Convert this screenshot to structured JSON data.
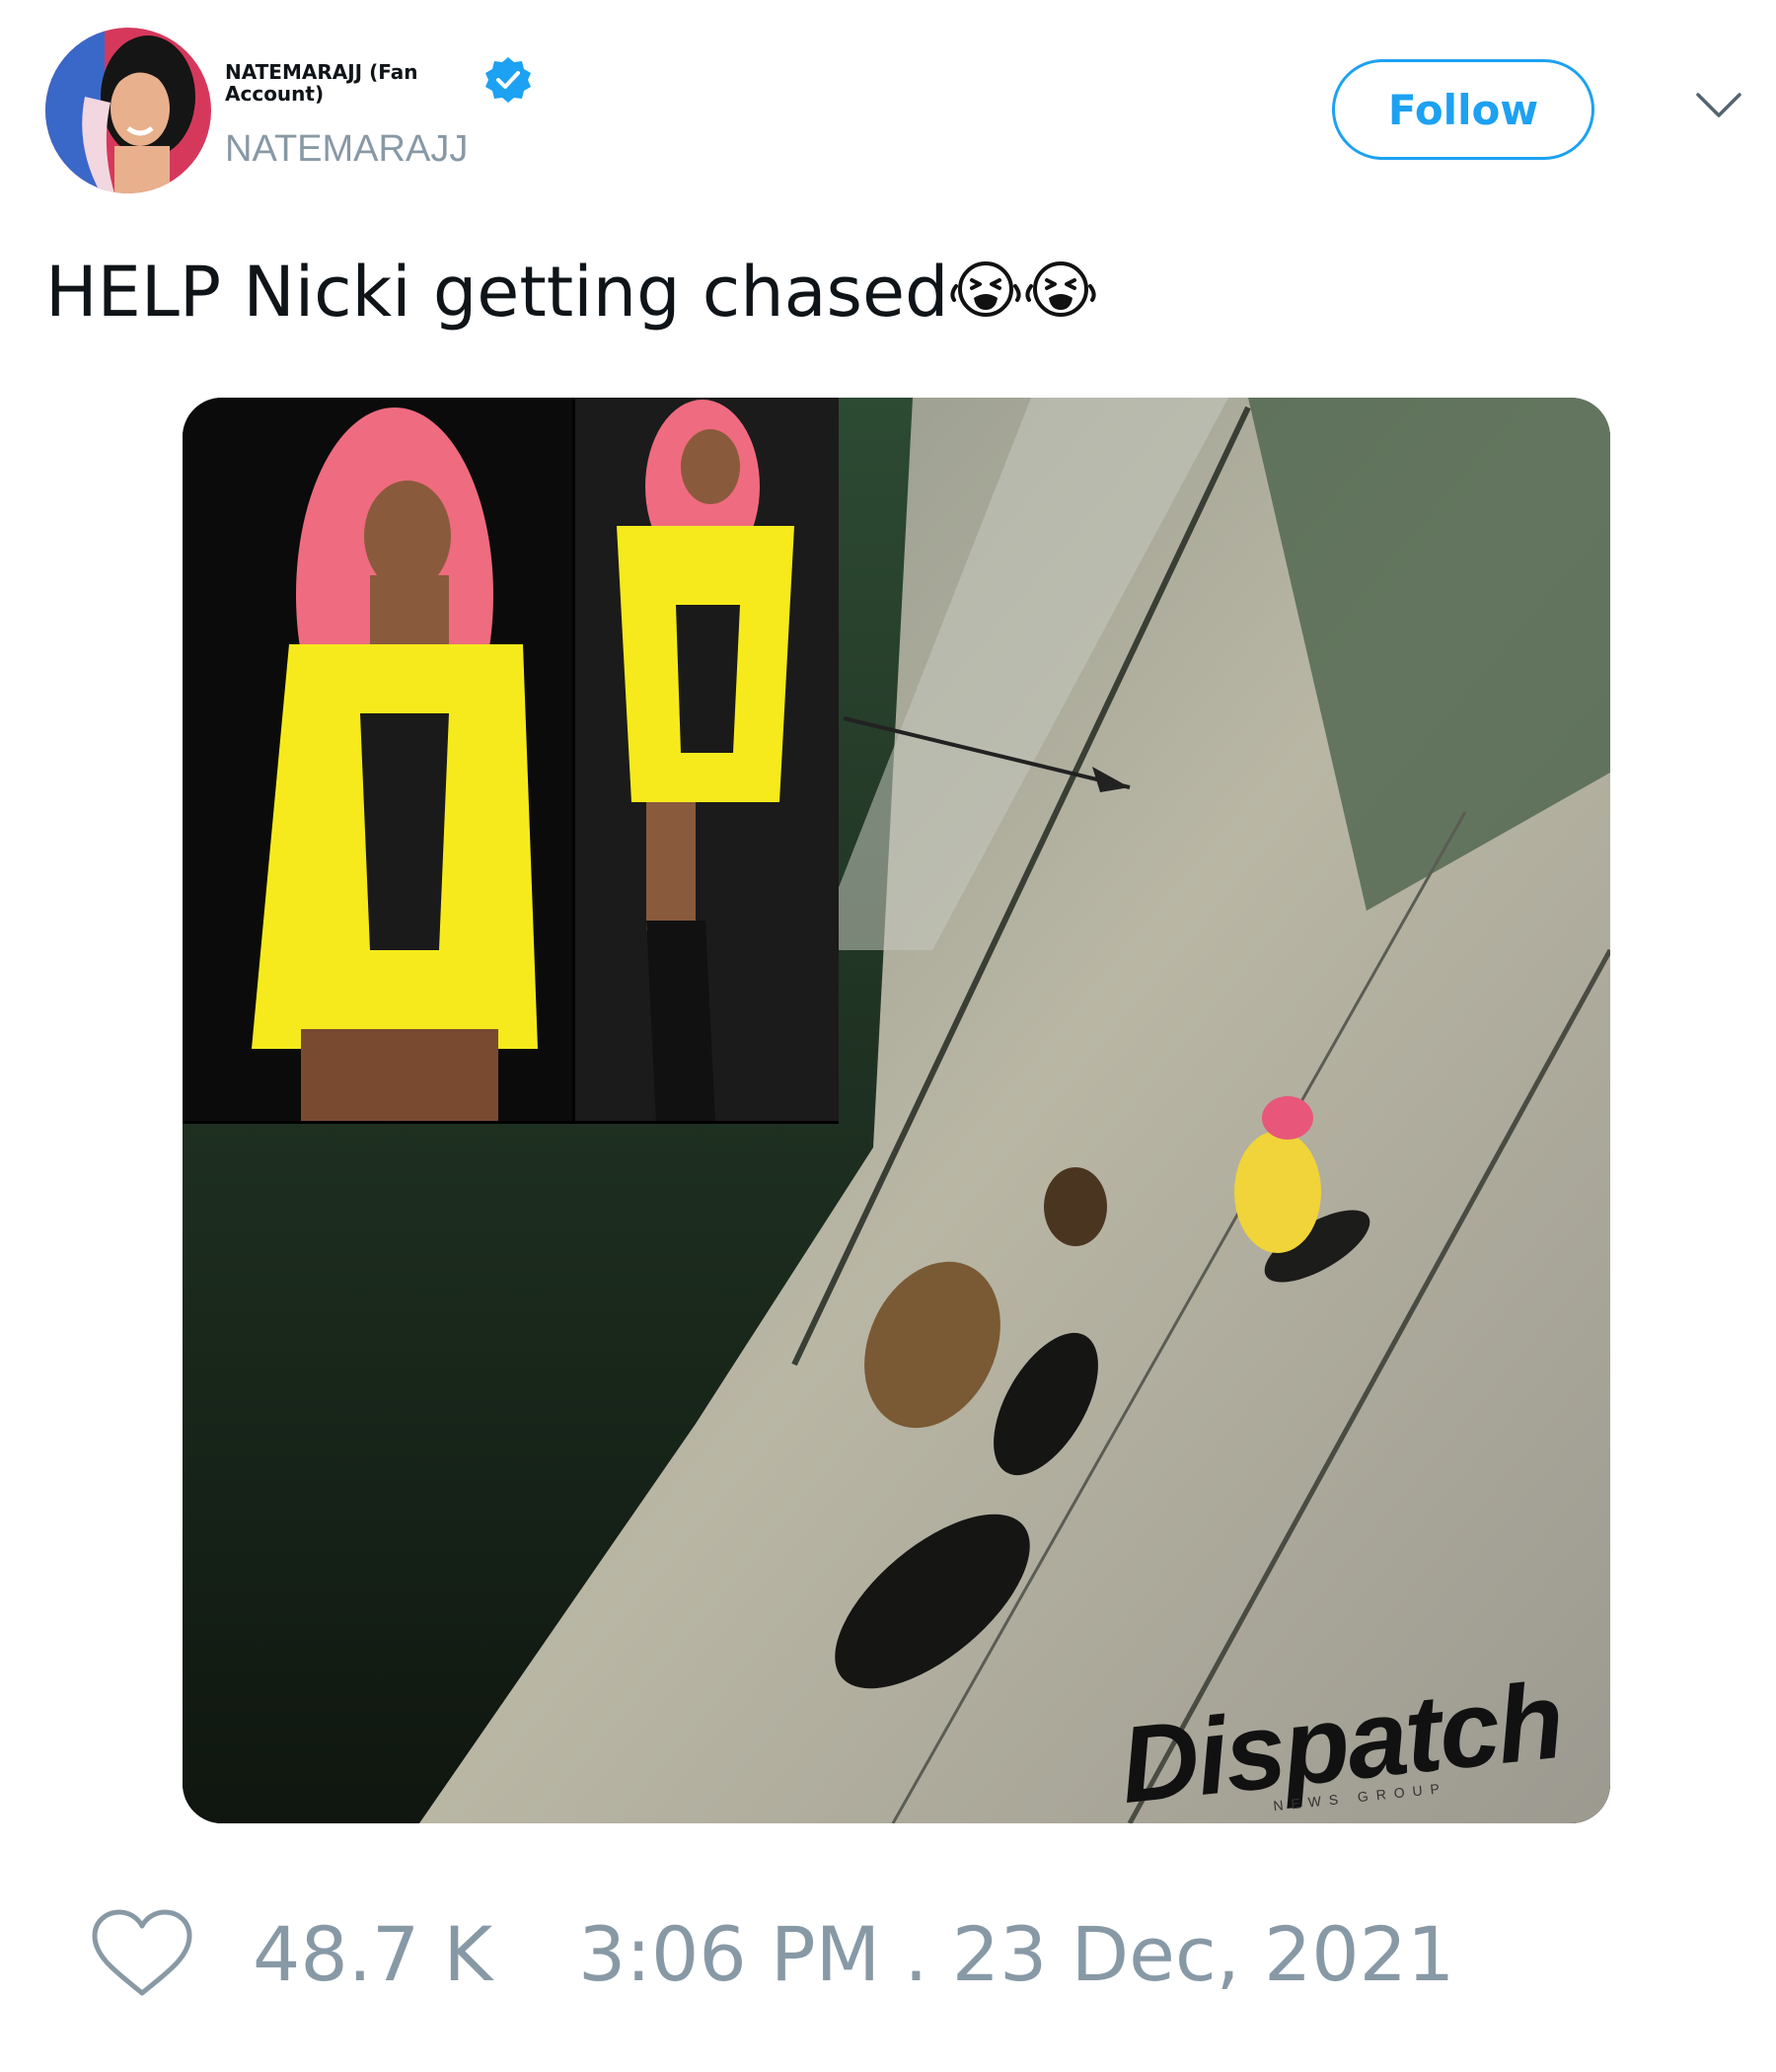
{
  "author": {
    "display_name": "NATEMARAJJ (Fan Account)",
    "handle": "NATEMARAJJ",
    "verified": true
  },
  "follow_label": "Follow",
  "tweet": {
    "text": "HELP Nicki getting chased",
    "emojis": [
      "loudly-crying-face",
      "loudly-crying-face"
    ]
  },
  "media": {
    "watermark": "Dispatch",
    "watermark_sub": "NEWS GROUP"
  },
  "stats": {
    "likes": "48.7 K",
    "timestamp": "3:06 PM . 23 Dec, 2021"
  },
  "colors": {
    "accent": "#1da1f2",
    "muted": "#8899a6",
    "text": "#0f1419"
  }
}
